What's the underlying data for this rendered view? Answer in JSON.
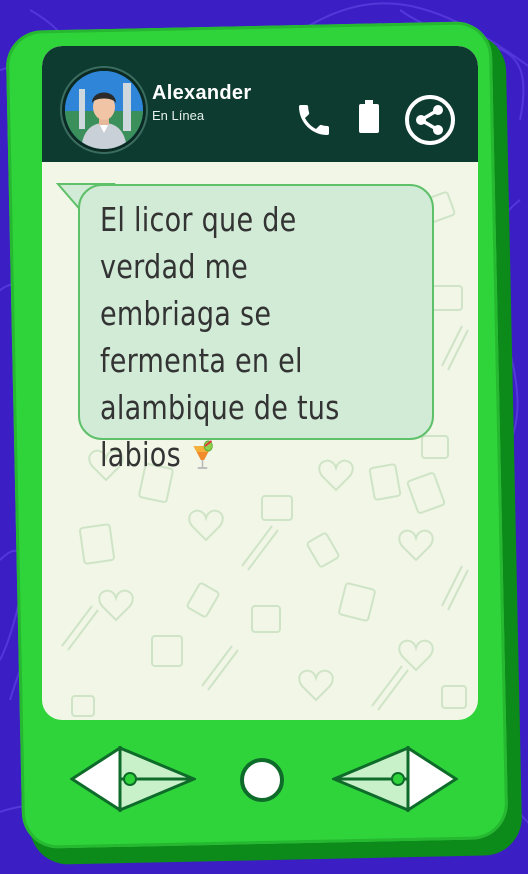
{
  "contact": {
    "name": "Alexander",
    "status": "En Línea"
  },
  "message": {
    "text": "El licor que de verdad me embriaga se fermenta en el alambique de tus labios"
  },
  "icons": {
    "call": "phone-icon",
    "battery": "battery-icon",
    "share": "share-icon",
    "emoji": "tropical-drink-emoji",
    "back": "arrow-left-icon",
    "home": "home-circle-icon",
    "forward": "arrow-right-icon"
  },
  "colors": {
    "background": "#3b1fc4",
    "phone_body": "#2fd43a",
    "header": "#0e3b30",
    "bubble": "#d1ebd6",
    "screen": "#f1f6e6"
  }
}
